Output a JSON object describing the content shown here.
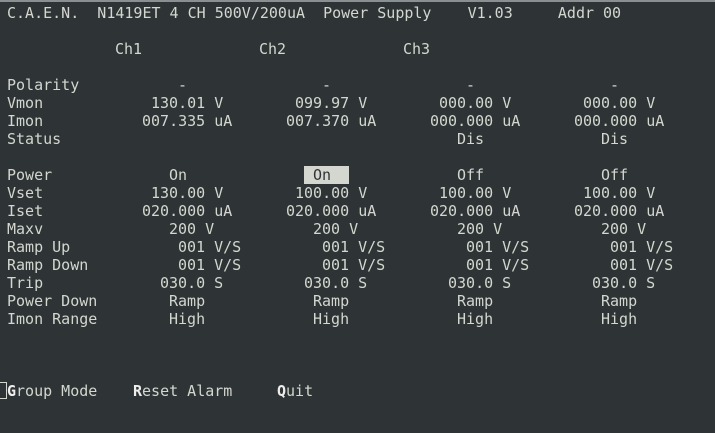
{
  "header": "C.A.E.N.  N1419ET 4 CH 500V/200uA  Power Supply    V1.03     Addr 00",
  "channels": [
    "Ch1",
    "Ch2",
    "Ch3"
  ],
  "rows": [
    {
      "label": "Polarity",
      "values": [
        "-",
        "-",
        "-",
        "-"
      ]
    },
    {
      "label": "Vmon",
      "values": [
        "130.01 V",
        "099.97 V",
        "000.00 V",
        "000.00 V"
      ]
    },
    {
      "label": "Imon",
      "values": [
        "007.335 uA",
        "007.370 uA",
        "000.000 uA",
        "000.000 uA"
      ]
    },
    {
      "label": "Status",
      "values": [
        "",
        "",
        "Dis",
        "Dis"
      ]
    },
    {
      "label": "Power",
      "values": [
        "On",
        "On",
        "Off",
        "Off"
      ]
    },
    {
      "label": "Vset",
      "values": [
        "130.00 V",
        "100.00 V",
        "100.00 V",
        "100.00 V"
      ]
    },
    {
      "label": "Iset",
      "values": [
        "020.000 uA",
        "020.000 uA",
        "020.000 uA",
        "020.000 uA"
      ]
    },
    {
      "label": "Maxv",
      "values": [
        "200 V",
        "200 V",
        "200 V",
        "200 V"
      ]
    },
    {
      "label": "Ramp Up",
      "values": [
        "001 V/S",
        "001 V/S",
        "001 V/S",
        "001 V/S"
      ]
    },
    {
      "label": "Ramp Down",
      "values": [
        "001 V/S",
        "001 V/S",
        "001 V/S",
        "001 V/S"
      ]
    },
    {
      "label": "Trip",
      "values": [
        "030.0 S",
        "030.0 S",
        "030.0 S",
        "030.0 S"
      ]
    },
    {
      "label": "Power Down",
      "values": [
        "Ramp",
        "Ramp",
        "Ramp",
        "Ramp"
      ]
    },
    {
      "label": "Imon Range",
      "values": [
        "High",
        "High",
        "High",
        "High"
      ]
    }
  ],
  "selected": {
    "row": 4,
    "channel": 1
  },
  "menu": [
    {
      "key": "G",
      "rest": "roup Mode"
    },
    {
      "key": "R",
      "rest": "eset Alarm"
    },
    {
      "key": "Q",
      "rest": "uit"
    }
  ]
}
